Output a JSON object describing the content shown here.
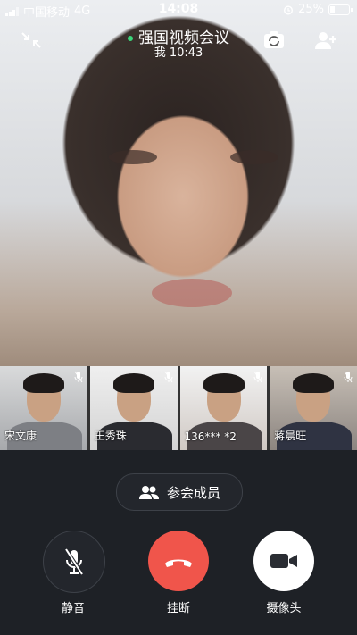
{
  "status_bar": {
    "carrier": "中国移动",
    "network": "4G",
    "time": "14:08",
    "battery": "25%",
    "battery_level": 0.25
  },
  "header": {
    "title": "强国视频会议",
    "subtitle": "我 10:43"
  },
  "participants": [
    {
      "name": "宋文康"
    },
    {
      "name": "王秀珠"
    },
    {
      "name": "136*** *2"
    },
    {
      "name": "蒋晨旺"
    }
  ],
  "members_button": {
    "label": "参会成员"
  },
  "controls": {
    "mute": {
      "label": "静音"
    },
    "hangup": {
      "label": "挂断"
    },
    "camera": {
      "label": "摄像头"
    }
  },
  "colors": {
    "accent_green": "#3bd57a",
    "hangup_red": "#f0554b",
    "panel_bg": "#1e2126"
  }
}
